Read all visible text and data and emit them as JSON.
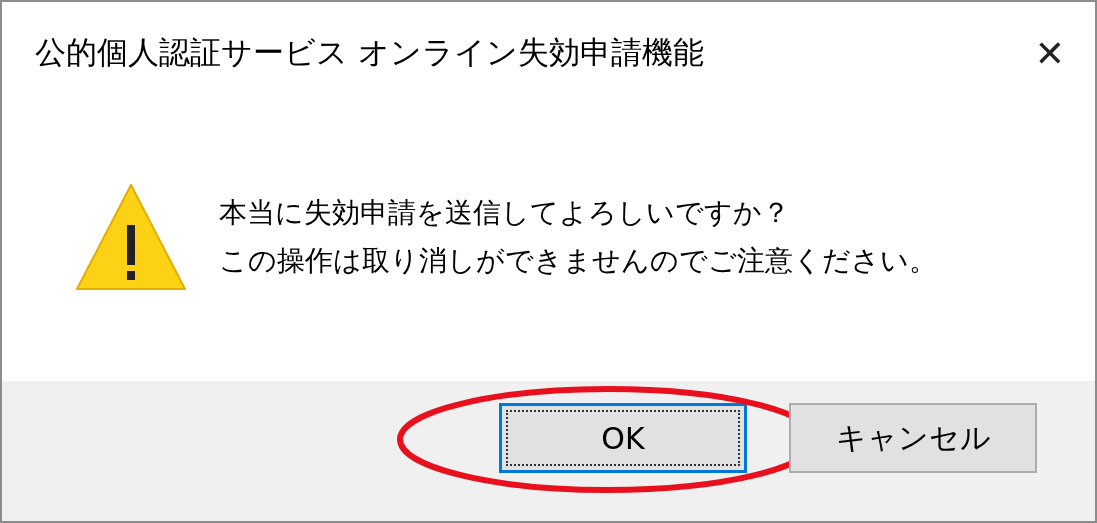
{
  "window": {
    "title": "公的個人認証サービス オンライン失効申請機能",
    "close": "✕"
  },
  "message": {
    "kind": "warning",
    "lines": [
      "本当に失効申請を送信してよろしいですか？",
      "この操作は取り消しができませんのでご注意ください。"
    ]
  },
  "buttons": [
    {
      "label": "OK",
      "default": true,
      "circled": true
    },
    {
      "label": "キャンセル",
      "default": false,
      "circled": false
    }
  ]
}
